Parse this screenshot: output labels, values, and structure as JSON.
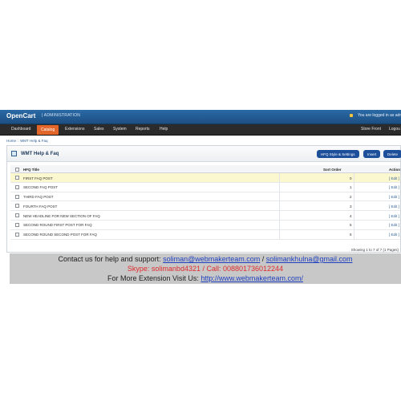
{
  "header": {
    "brand": "OpenCart",
    "section": "| ADMINISTRATION",
    "login_note": "You are logged in as adr"
  },
  "menu": {
    "items": [
      "Dashboard",
      "Catalog",
      "Extensions",
      "Sales",
      "System",
      "Reports",
      "Help"
    ],
    "active": "Catalog",
    "store_front": "Store Front",
    "logout": "Logou"
  },
  "breadcrumb": {
    "home": "Home",
    "separator": "::",
    "current": "WMT Help & Faq"
  },
  "panel": {
    "title": "WMT Help & Faq",
    "buttons": {
      "style": "HFQ Style & Settings",
      "insert": "Insert",
      "delete": "Delete"
    }
  },
  "table": {
    "headers": {
      "title": "HFQ Title",
      "sort_order": "Sort Order",
      "action": "Action"
    },
    "rows": [
      {
        "title": "FIRST FAQ POST",
        "sort_order": "0",
        "action": "[ Edit ]",
        "highlight": true
      },
      {
        "title": "SECOND FAQ POST",
        "sort_order": "1",
        "action": "[ Edit ]"
      },
      {
        "title": "THIRD FAQ POST",
        "sort_order": "2",
        "action": "[ Edit ]"
      },
      {
        "title": "FOURTH FAQ POST",
        "sort_order": "3",
        "action": "[ Edit ]"
      },
      {
        "title": "NEW HEADLINE FOR NEW SECTION OF FAQ",
        "sort_order": "4",
        "action": "[ Edit ]"
      },
      {
        "title": "SECOND ROUND FIRST POST FOR FAQ",
        "sort_order": "5",
        "action": "[ Edit ]"
      },
      {
        "title": "SECOND ROUND SECOND POST FOR FAQ",
        "sort_order": "6",
        "action": "[ Edit ]"
      }
    ]
  },
  "pagination": "Showing 1 to 7 of 7 (1 Pages)",
  "contact": {
    "line1_prefix": "Contact us for help and support: ",
    "email1": "soliman@webmakerteam.com",
    "line1_sep": " / ",
    "email2": "solimankhulna@gmail.com",
    "skype": "Skype: solimanbd4321",
    "line2_sep": " / ",
    "call": "Call: 008801736012244",
    "line3_prefix": "For More Extension Visit Us: ",
    "website": "http://www.webmakerteam.com/"
  }
}
